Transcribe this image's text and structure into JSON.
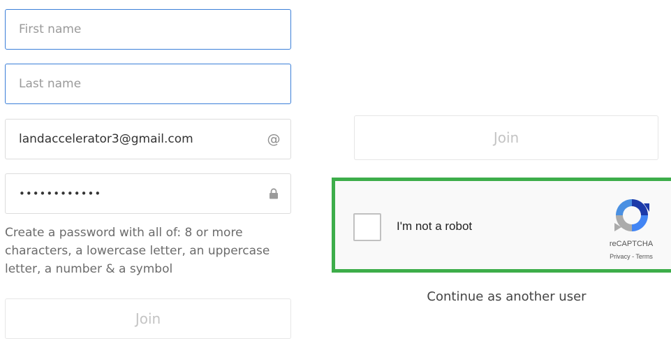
{
  "form": {
    "first_name": {
      "value": "",
      "placeholder": "First name"
    },
    "last_name": {
      "value": "",
      "placeholder": "Last name"
    },
    "email": {
      "value": "landaccelerator3@gmail.com",
      "placeholder": "",
      "suffix_symbol": "@"
    },
    "password": {
      "value": "••••••••••••",
      "icon": "lock-icon"
    },
    "password_hint": "Create a password with all of: 8 or more characters, a lowercase letter, an uppercase letter, a number & a symbol",
    "join_label": "Join"
  },
  "right": {
    "join_label": "Join",
    "continue_label": "Continue as another user"
  },
  "recaptcha": {
    "label": "I'm not a robot",
    "brand": "reCAPTCHA",
    "privacy": "Privacy",
    "separator": " - ",
    "terms": "Terms",
    "highlight_color": "#3dad4a"
  },
  "colors": {
    "focus_border": "#3b7fd8",
    "disabled_text": "#c4c4c4"
  }
}
